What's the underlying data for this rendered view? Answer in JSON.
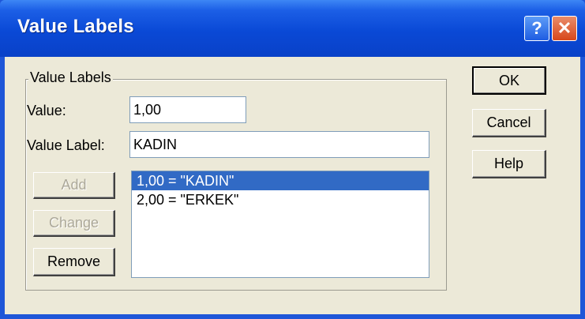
{
  "window": {
    "title": "Value Labels",
    "help_glyph": "?",
    "close_glyph": "✕",
    "colors": {
      "titlebar": "#0a49d6",
      "selection": "#316ac5",
      "face": "#ece9d8"
    }
  },
  "group": {
    "legend": "Value Labels",
    "value_label": "Value:",
    "value": "1,00",
    "value_label_label": "Value Label:",
    "value_label_value": "KADIN"
  },
  "buttons": {
    "add": "Add",
    "change": "Change",
    "remove": "Remove",
    "ok": "OK",
    "cancel": "Cancel",
    "help": "Help"
  },
  "list": {
    "items": [
      "1,00 = \"KADIN\"",
      "2,00 = \"ERKEK\""
    ],
    "selected_index": 0
  }
}
